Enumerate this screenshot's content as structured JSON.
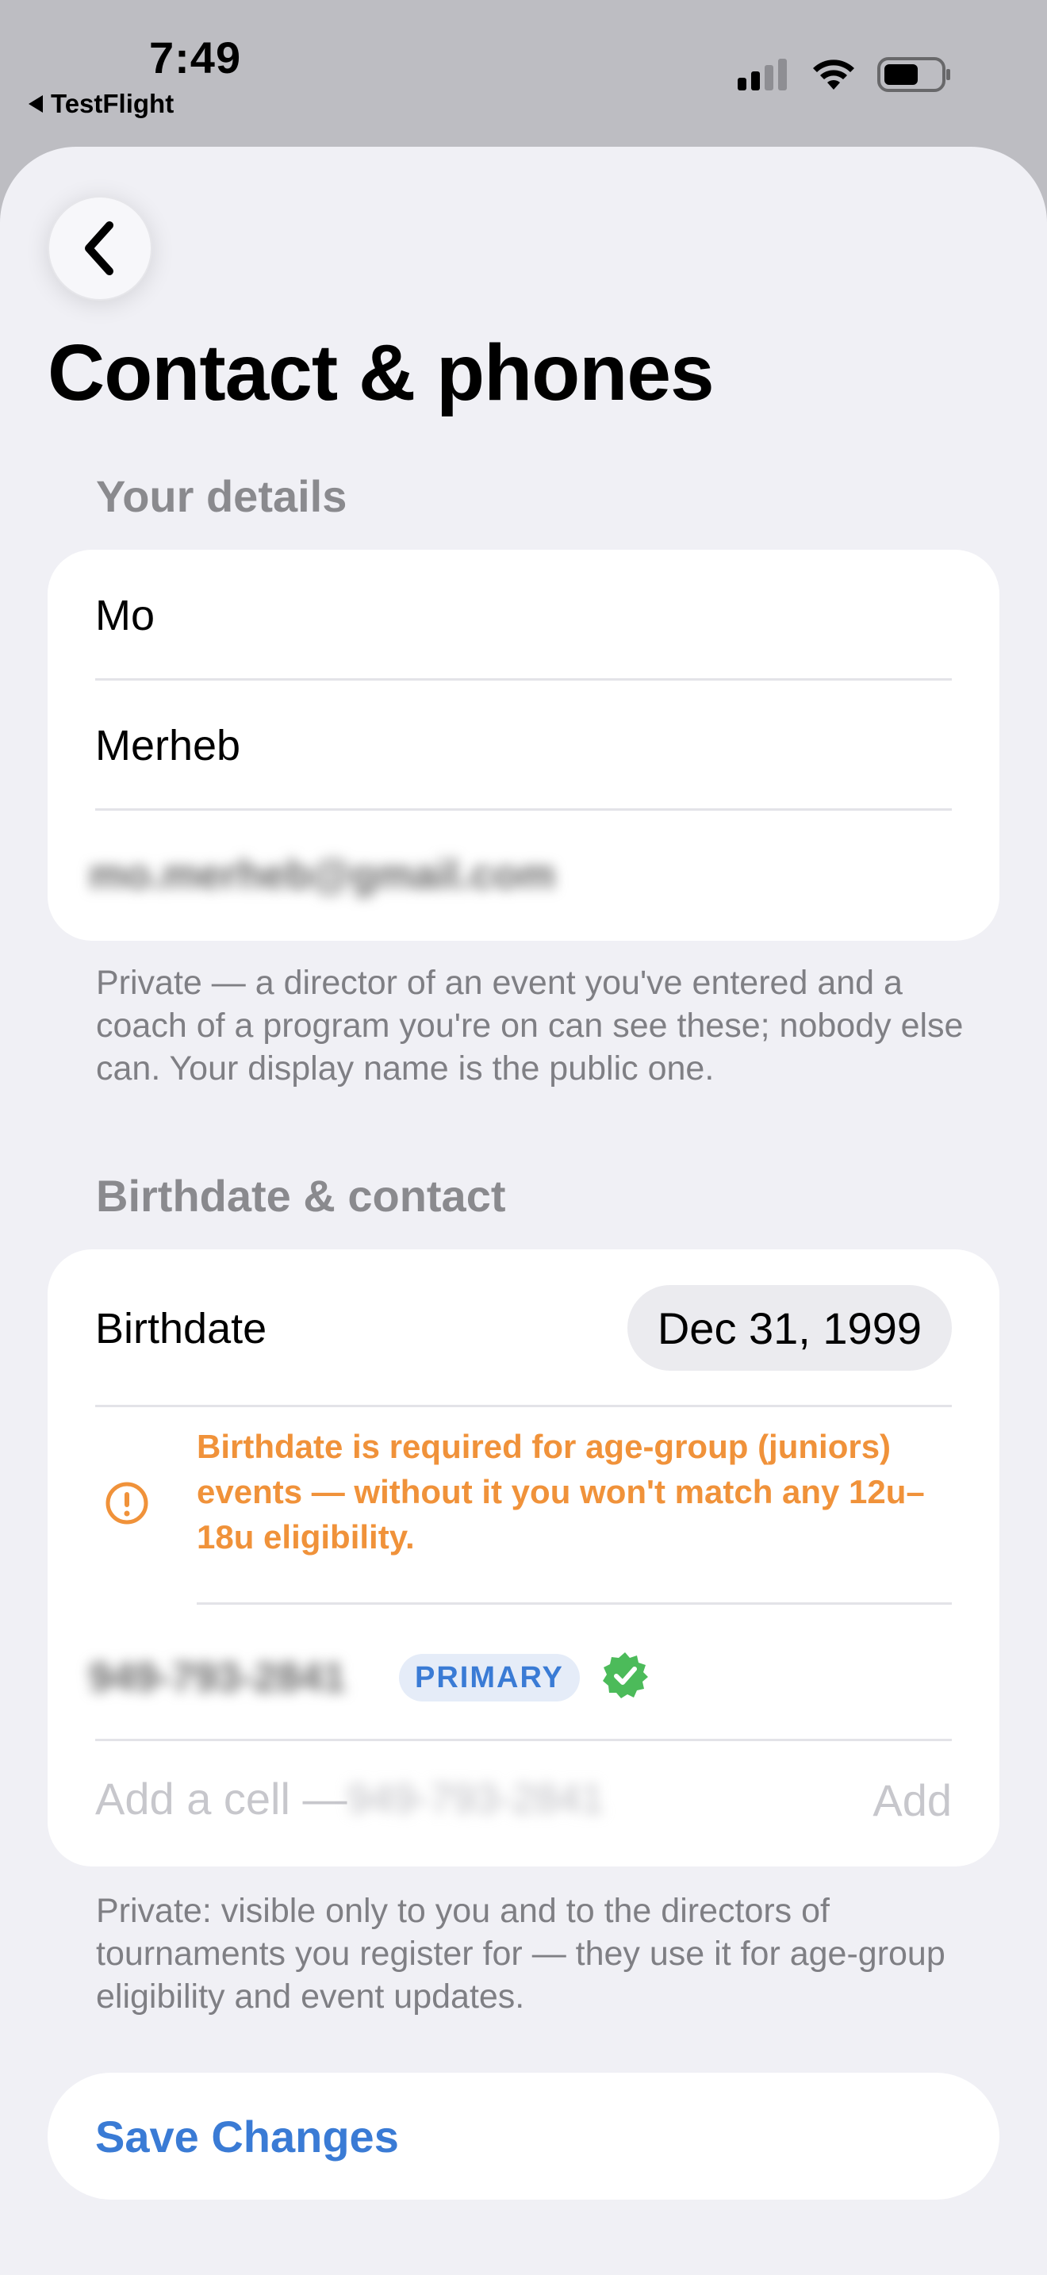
{
  "status_bar": {
    "time": "7:49",
    "back_app": "TestFlight",
    "icons": [
      "cellular-signal-icon",
      "wifi-icon",
      "battery-icon"
    ]
  },
  "header": {
    "back_icon": "chevron-left-icon",
    "title": "Contact & phones"
  },
  "details": {
    "section_title": "Your details",
    "first_name": "Mo",
    "last_name": "Merheb",
    "email_redacted": "mo.merheb@gmail.com",
    "footnote": "Private — a director of an event you've entered and a coach of a program you're on can see these; nobody else can. Your display name is the public one."
  },
  "contact": {
    "section_title": "Birthdate & contact",
    "birthdate_label": "Birthdate",
    "birthdate_value": "Dec 31, 1999",
    "warning_icon": "exclamation-circle-icon",
    "warning_text": "Birthdate is required for age-group (juniors) events — without it you won't match any 12u–18u eligibility.",
    "phone_redacted": "949-793-2841",
    "primary_badge": "PRIMARY",
    "verified_icon": "verified-check-icon",
    "add_cell_placeholder": "Add a cell — ",
    "add_cell_redacted": "949-793-2841",
    "add_label": "Add",
    "footnote": "Private: visible only to you and to the directors of tournaments you register for — they use it for age-group eligibility and event updates."
  },
  "save": {
    "label": "Save Changes"
  },
  "colors": {
    "accent": "#3a7bd5",
    "warning": "#f0923a",
    "verified": "#4cbb5a",
    "background": "#f0f0f5"
  }
}
